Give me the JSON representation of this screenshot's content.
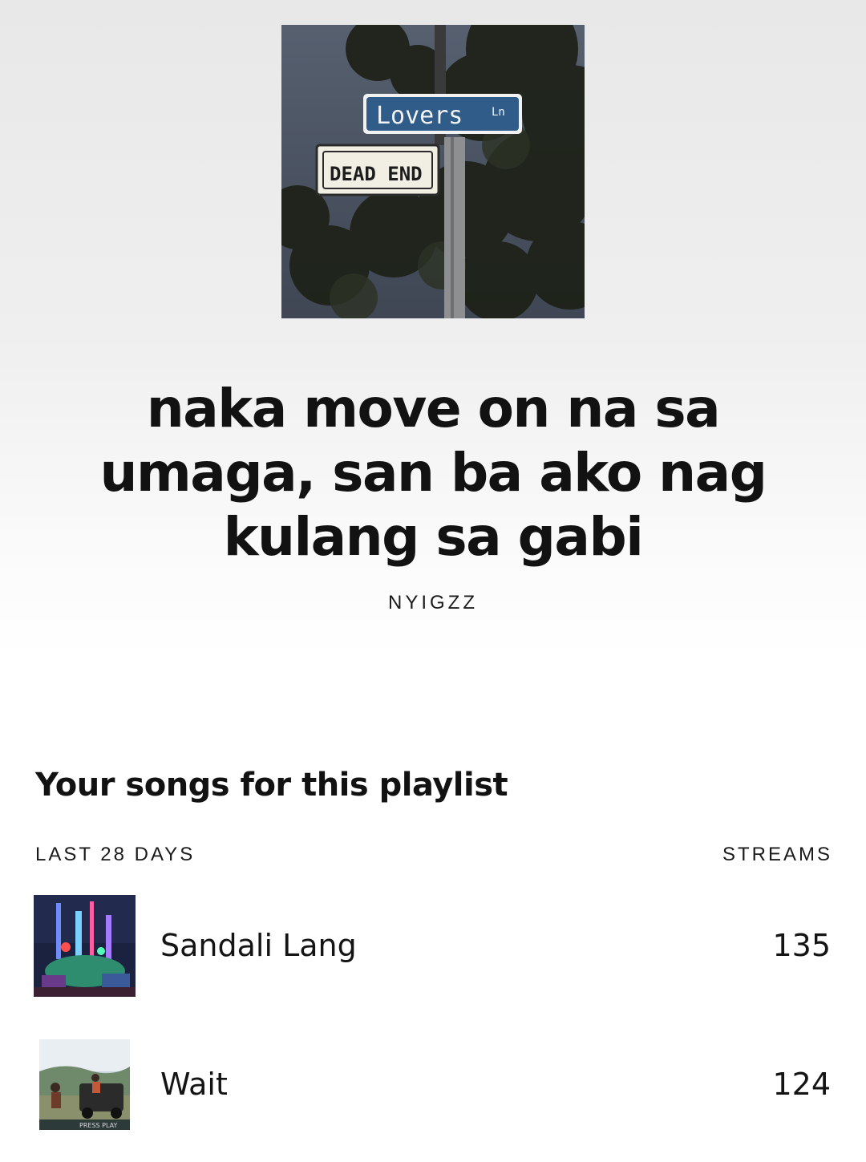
{
  "playlist": {
    "title": "naka move on na sa umaga, san ba ako nag kulang sa gabi",
    "owner": "NYIGZZ",
    "cover_sign_top": "Lovers Ln",
    "cover_sign_bottom": "DEAD END"
  },
  "songs_section": {
    "heading": "Your songs for this playlist",
    "period_label": "LAST 28 DAYS",
    "metric_label": "STREAMS",
    "songs": [
      {
        "title": "Sandali Lang",
        "streams": "135",
        "art_icon": "album-art-neon-room"
      },
      {
        "title": "Wait",
        "streams": "124",
        "art_icon": "album-art-press-play",
        "art_text": "PRESS PLAY"
      }
    ]
  }
}
